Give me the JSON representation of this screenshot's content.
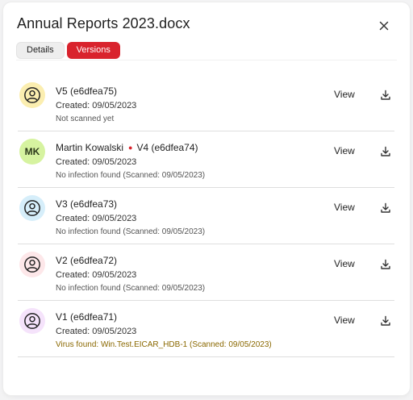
{
  "dialog": {
    "title": "Annual Reports 2023.docx",
    "close_icon": "close-icon"
  },
  "tabs": [
    {
      "label": "Details",
      "active": false
    },
    {
      "label": "Versions",
      "active": true
    }
  ],
  "colors": {
    "accent": "#d9232d",
    "virus_text": "#8a6800"
  },
  "versions": [
    {
      "avatar_type": "user-icon",
      "avatar_color": "#fbeeb0",
      "author": "",
      "label": "V5 (e6dfea75)",
      "created": "Created: 09/05/2023",
      "status": "Not scanned yet",
      "view_label": "View",
      "download_icon": "download-icon"
    },
    {
      "avatar_type": "initials",
      "avatar_initials": "MK",
      "avatar_color": "#d6f3a0",
      "author": "Martin Kowalski",
      "label": "V4 (e6dfea74)",
      "created": "Created: 09/05/2023",
      "status": "No infection found (Scanned: 09/05/2023)",
      "view_label": "View",
      "download_icon": "download-icon"
    },
    {
      "avatar_type": "user-icon",
      "avatar_color": "#d6eefa",
      "author": "",
      "label": "V3 (e6dfea73)",
      "created": "Created: 09/05/2023",
      "status": "No infection found (Scanned: 09/05/2023)",
      "view_label": "View",
      "download_icon": "download-icon"
    },
    {
      "avatar_type": "user-icon",
      "avatar_color": "#fde7e9",
      "author": "",
      "label": "V2 (e6dfea72)",
      "created": "Created: 09/05/2023",
      "status": "No infection found (Scanned: 09/05/2023)",
      "view_label": "View",
      "download_icon": "download-icon"
    },
    {
      "avatar_type": "user-icon",
      "avatar_color": "#f5e3fb",
      "author": "",
      "label": "V1 (e6dfea71)",
      "created": "Created: 09/05/2023",
      "status": "Virus found: Win.Test.EICAR_HDB-1 (Scanned: 09/05/2023)",
      "status_kind": "virus",
      "view_label": "View",
      "download_icon": "download-icon"
    }
  ]
}
